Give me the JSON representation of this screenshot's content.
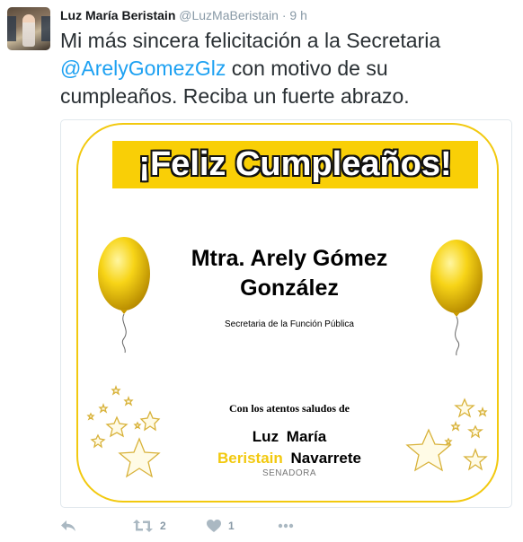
{
  "tweet": {
    "author_name": "Luz María Beristain",
    "author_handle": "@LuzMaBeristain",
    "separator": "·",
    "time": "9 h",
    "text_before": "Mi más sincera felicitación a la Secretaria ",
    "mention": "@ArelyGomezGlz",
    "text_after": " con motivo de su cumpleaños. Reciba un fuerte abrazo."
  },
  "card": {
    "banner_title": "¡Feliz Cumpleaños!",
    "recipient_line1": "Mtra. Arely Gómez",
    "recipient_line2": "González",
    "recipient_role": "Secretaria de la Función Pública",
    "greeting": "Con los  atentos saludos de",
    "sender_line1": "Luz  María",
    "sender_gold": "Beristain",
    "sender_black": "Navarrete",
    "sender_title": "SENADORA"
  },
  "actions": {
    "reply_icon": "reply-icon",
    "retweet_icon": "retweet-icon",
    "retweet_count": "2",
    "like_icon": "heart-icon",
    "like_count": "1",
    "more_icon": "more-icon"
  },
  "colors": {
    "mention": "#1da1f2",
    "gold": "#f2c90f",
    "banner": "#f9cf06",
    "action_gray": "#aab8c2"
  }
}
